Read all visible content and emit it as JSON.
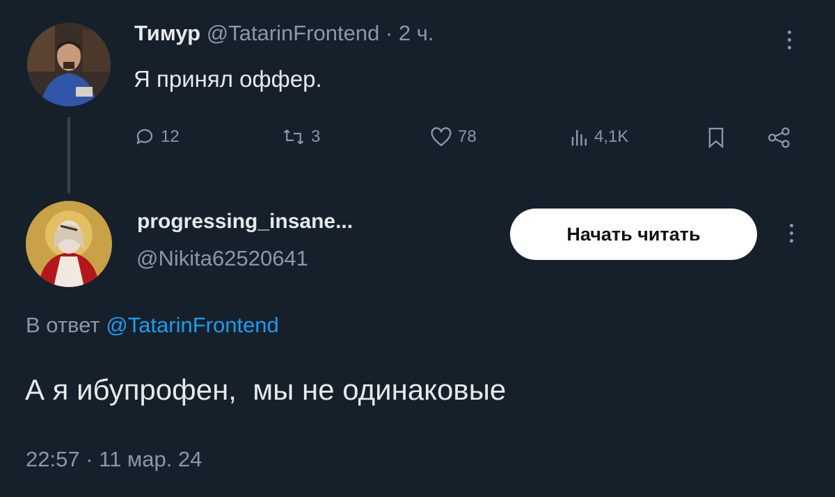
{
  "tweet1": {
    "author_name": "Тимур",
    "handle": "@TatarinFrontend",
    "time": "· 2 ч.",
    "text": "Я принял оффер.",
    "actions": {
      "replies": "12",
      "retweets": "3",
      "likes": "78",
      "views": "4,1K"
    }
  },
  "tweet2": {
    "author_name": "progressing_insane...",
    "handle": "@Nikita62520641",
    "follow_label": "Начать читать",
    "reply_prefix": "В ответ",
    "reply_to": "@TatarinFrontend",
    "text": "А я ибупрофен,  мы не одинаковые",
    "timestamp": "22:57 · 11 мар. 24"
  },
  "colors": {
    "background": "#15202b",
    "text": "#e7e9ea",
    "muted": "#8b98a5",
    "link": "#1d9bf0"
  }
}
